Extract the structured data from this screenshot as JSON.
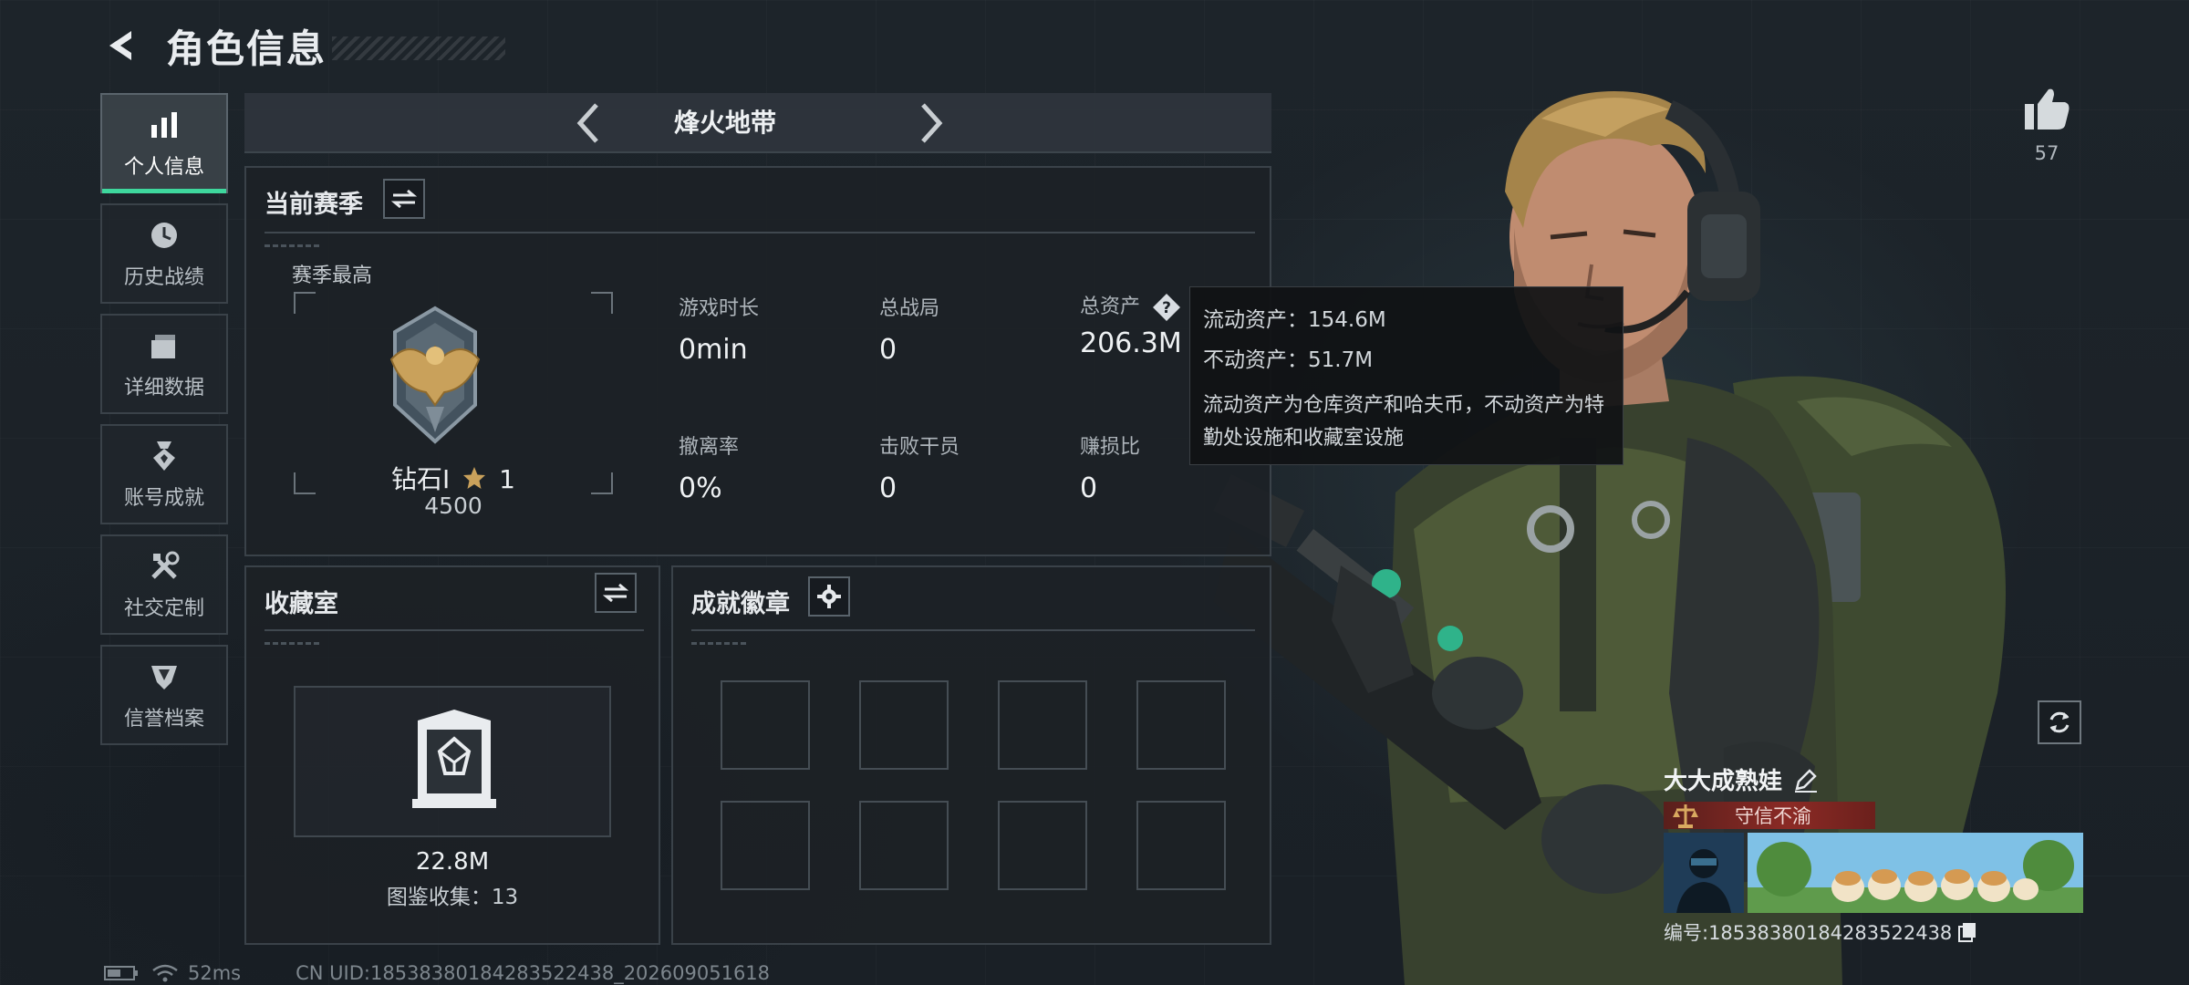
{
  "header": {
    "title": "角色信息"
  },
  "sidebar": {
    "items": [
      {
        "label": "个人信息",
        "icon": "bar-chart-icon",
        "active": true
      },
      {
        "label": "历史战绩",
        "icon": "clock-icon",
        "active": false
      },
      {
        "label": "详细数据",
        "icon": "folder-icon",
        "active": false
      },
      {
        "label": "账号成就",
        "icon": "medal-icon",
        "active": false
      },
      {
        "label": "社交定制",
        "icon": "tools-icon",
        "active": false
      },
      {
        "label": "信誉档案",
        "icon": "shield-badge-icon",
        "active": false
      }
    ]
  },
  "mode": {
    "name": "烽火地带"
  },
  "season": {
    "title": "当前赛季",
    "high_label": "赛季最高",
    "rank_name": "钻石I",
    "rank_stars": "1",
    "rank_score": "4500",
    "stats": [
      {
        "label": "游戏时长",
        "value": "0min"
      },
      {
        "label": "总战局",
        "value": "0"
      },
      {
        "label": "总资产",
        "value": "206.3M"
      },
      {
        "label": "撤离率",
        "value": "0%"
      },
      {
        "label": "击败干员",
        "value": "0"
      },
      {
        "label": "赚损比",
        "value": "0"
      }
    ]
  },
  "tooltip": {
    "liquid": "流动资产：154.6M",
    "fixed": "不动资产：51.7M",
    "description": "流动资产为仓库资产和哈夫币，不动资产为特勤处设施和收藏室设施"
  },
  "collection": {
    "title": "收藏室",
    "value": "22.8M",
    "count": "图鉴收集：13"
  },
  "achievements": {
    "title": "成就徽章"
  },
  "like": {
    "count": "57"
  },
  "player": {
    "name": "大大成熟娃",
    "honor": "守信不渝",
    "uid": "编号:1853838018428352243​8"
  },
  "footer": {
    "latency": "52ms",
    "cn_uid": "CN UID:1853838018428352​2438_202609051618"
  },
  "colors": {
    "accent": "#3ed79d",
    "honor_red": "#8b2a25",
    "panel_border": "#3a4249"
  }
}
